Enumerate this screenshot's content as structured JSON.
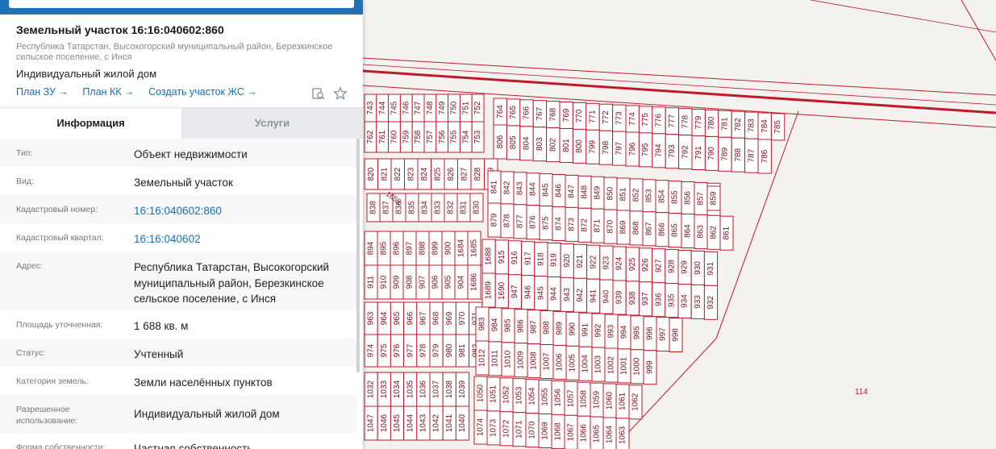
{
  "card": {
    "title": "Земельный участок 16:16:040602:860",
    "address": "Республика Татарстан, Высокогорский муниципальный район, Березкинское сельское поселение, с Инся",
    "usage": "Индивидуальный жилой дом",
    "links": [
      "План ЗУ →",
      "План КК →",
      "Создать участок ЖС →"
    ]
  },
  "tabs": [
    "Информация",
    "Услуги"
  ],
  "info": [
    {
      "label": "Тип:",
      "value": "Объект недвижимости"
    },
    {
      "label": "Вид:",
      "value": "Земельный участок"
    },
    {
      "label": "Кадастровый номер:",
      "value": "16:16:040602:860",
      "link": true
    },
    {
      "label": "Кадастровый квартал:",
      "value": "16:16:040602",
      "link": true
    },
    {
      "label": "Адрес:",
      "value": "Республика Татарстан, Высокогорский муниципальный район, Березкинское сельское поселение, с Инся"
    },
    {
      "label": "Площадь уточненная:",
      "value": "1 688 кв. м"
    },
    {
      "label": "Статус:",
      "value": "Учтенный"
    },
    {
      "label": "Категория земель:",
      "value": "Земли населённых пунктов"
    },
    {
      "label": "Разрешенное использование:",
      "value": "Индивидуальный жилой дом"
    },
    {
      "label": "Форма собственности:",
      "value": "Частная собственность"
    }
  ],
  "icons": {
    "search_map": "map-search-icon",
    "favorite": "star-icon"
  },
  "colors": {
    "parcel_border": "#c0192b",
    "selected_parcel": "#f7ec7a",
    "accent": "#1e72b8",
    "link": "#1a6fb3"
  },
  "map": {
    "selected": "860",
    "zone_label": "114",
    "labels": {
      "r1a": [
        "743",
        "744",
        "745",
        "746",
        "747",
        "748",
        "749",
        "750",
        "751",
        "752"
      ],
      "r1b": [
        "762",
        "761",
        "760",
        "759",
        "758",
        "757",
        "756",
        "755",
        "754",
        "753"
      ],
      "r2a": [
        "764",
        "765",
        "766",
        "767",
        "768",
        "769",
        "770",
        "771",
        "772",
        "773",
        "774",
        "775",
        "776",
        "777",
        "778",
        "779",
        "780",
        "781",
        "782",
        "783",
        "784",
        "785"
      ],
      "r2b": [
        "806",
        "805",
        "804",
        "803",
        "802",
        "801",
        "800",
        "799",
        "798",
        "797",
        "796",
        "795",
        "794",
        "793",
        "792",
        "791",
        "790",
        "789",
        "788",
        "787",
        "786"
      ],
      "r3a": [
        "820",
        "821",
        "822",
        "823",
        "824",
        "825",
        "826",
        "827",
        "828",
        "829"
      ],
      "r3b": [
        "838",
        "837",
        "836",
        "835",
        "834",
        "833",
        "832",
        "831",
        "830"
      ],
      "r3note": "1658",
      "r4a": [
        "841",
        "842",
        "843",
        "844",
        "845",
        "846",
        "847",
        "848",
        "849",
        "850",
        "851",
        "852",
        "853",
        "854",
        "855",
        "856",
        "857",
        "858"
      ],
      "r4b": [
        "879",
        "878",
        "877",
        "876",
        "875",
        "874",
        "873",
        "872",
        "871",
        "870",
        "869",
        "868",
        "867",
        "866",
        "865",
        "864",
        "863",
        "862",
        "861"
      ],
      "r4c": [
        "859"
      ],
      "r5a": [
        "894",
        "895",
        "896",
        "897",
        "898",
        "899",
        "900",
        "1684",
        "1685"
      ],
      "r5b": [
        "911",
        "910",
        "909",
        "908",
        "907",
        "906",
        "905",
        "904",
        "1686",
        "1687"
      ],
      "r6a": [
        "1688",
        "915",
        "916",
        "917",
        "918",
        "919",
        "920",
        "921",
        "922",
        "923",
        "924",
        "925",
        "926",
        "927",
        "928",
        "929",
        "930",
        "931"
      ],
      "r6b": [
        "1689",
        "1690",
        "947",
        "946",
        "945",
        "944",
        "943",
        "942",
        "941",
        "940",
        "939",
        "938",
        "937",
        "936",
        "935",
        "934",
        "933",
        "932"
      ],
      "r7a": [
        "963",
        "964",
        "965",
        "966",
        "967",
        "968",
        "969",
        "970",
        "971"
      ],
      "r7b": [
        "974",
        "975",
        "976",
        "977",
        "978",
        "979",
        "980",
        "981",
        "982"
      ],
      "r8a": [
        "983",
        "984",
        "985",
        "986",
        "987",
        "988",
        "989",
        "990",
        "991",
        "992",
        "993",
        "994",
        "995",
        "996",
        "997",
        "998"
      ],
      "r8b": [
        "1012",
        "1011",
        "1010",
        "1009",
        "1008",
        "1007",
        "1006",
        "1005",
        "1004",
        "1003",
        "1002",
        "1001",
        "1000",
        "999"
      ],
      "r9a": [
        "1032",
        "1033",
        "1034",
        "1035",
        "1036",
        "1037",
        "1038",
        "1039"
      ],
      "r9b": [
        "1047",
        "1046",
        "1045",
        "1044",
        "1043",
        "1042",
        "1041",
        "1040"
      ],
      "r10a": [
        "1050",
        "1051",
        "1052",
        "1053",
        "1054",
        "1055",
        "1056",
        "1057",
        "1058",
        "1059",
        "1060",
        "1061",
        "1062"
      ],
      "r10b": [
        "1074",
        "1073",
        "1072",
        "1071",
        "1070",
        "1069",
        "1068",
        "1067",
        "1066",
        "1065",
        "1064",
        "1063"
      ]
    }
  }
}
